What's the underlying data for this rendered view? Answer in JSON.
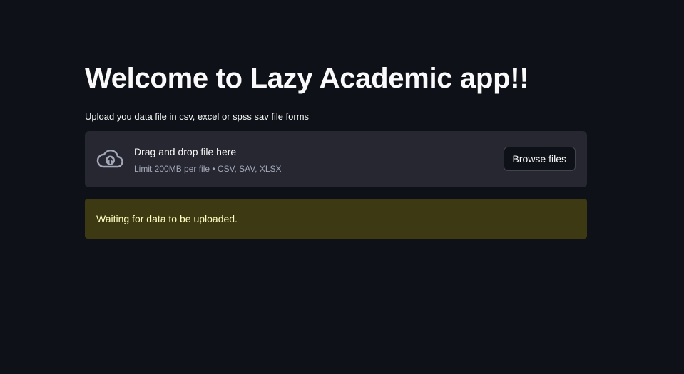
{
  "header": {
    "title": "Welcome to Lazy Academic app!!"
  },
  "uploader": {
    "label": "Upload you data file in csv, excel or spss sav file forms",
    "dropzone_title": "Drag and drop file here",
    "dropzone_limits": "Limit 200MB per file • CSV, SAV, XLSX",
    "browse_label": "Browse files",
    "icon": "cloud-upload-icon"
  },
  "alert": {
    "message": "Waiting for data to be uploaded.",
    "type": "warning",
    "background": "#3d3a13",
    "text_color": "#ffffc2"
  },
  "theme": {
    "background": "#0e1117",
    "surface": "#262730",
    "text": "#fafafa",
    "muted_text": "#a3a8b8"
  }
}
